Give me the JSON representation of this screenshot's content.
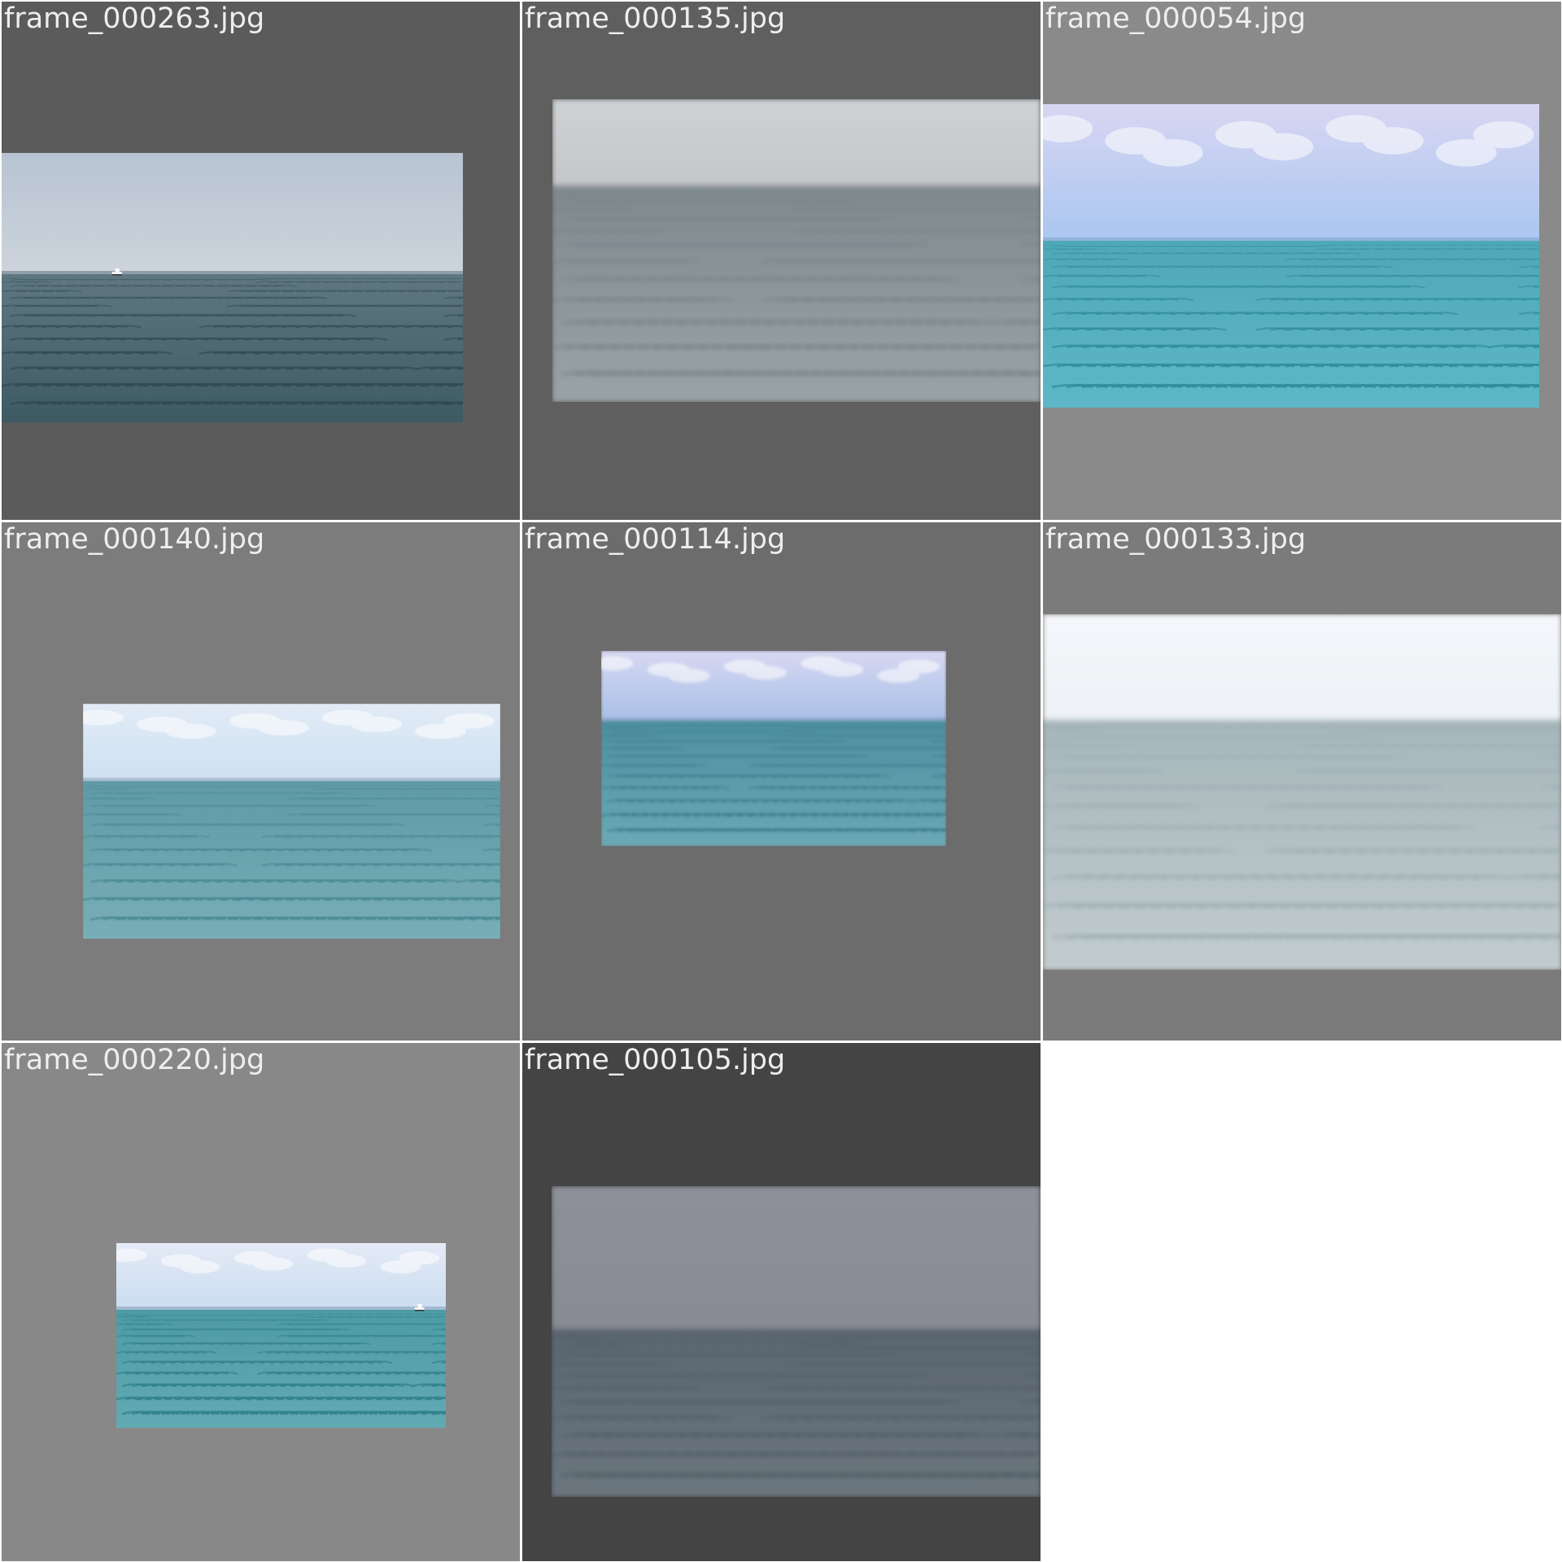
{
  "tiles": [
    {
      "filename": "frame_000263.jpg",
      "background": "#5b5b5b",
      "scene": {
        "sky_top": "#b8c4d2",
        "sky_bottom": "#cdd4dc",
        "horizon_fraction": 0.45,
        "water_top": "#5f7781",
        "water_bottom": "#3d5a63",
        "wave": "#2f4a52",
        "haze": "#8a98a4",
        "boat": true,
        "blur": 0
      }
    },
    {
      "filename": "frame_000135.jpg",
      "background": "#5f5f5f",
      "scene": {
        "sky_top": "#cfd2d5",
        "sky_bottom": "#c4c7ca",
        "horizon_fraction": 0.29,
        "water_top": "#7f8a8f",
        "water_bottom": "#9aa3a6",
        "wave": "#6a767b",
        "haze": "#9aa0a4",
        "boat": false,
        "blur": 3
      }
    },
    {
      "filename": "frame_000054.jpg",
      "background": "#8a8a8a",
      "scene": {
        "sky_top": "#d8d6f2",
        "sky_bottom": "#a9c6f0",
        "horizon_fraction": 0.45,
        "water_top": "#4fa8b8",
        "water_bottom": "#5cb7c6",
        "wave": "#2e8a98",
        "haze": "#8eb0d8",
        "boat": false,
        "blur": 0,
        "clouds": true
      }
    },
    {
      "filename": "frame_000140.jpg",
      "background": "#7c7c7c",
      "scene": {
        "sky_top": "#e2ebf6",
        "sky_bottom": "#cde0f2",
        "horizon_fraction": 0.33,
        "water_top": "#5f9aa6",
        "water_bottom": "#78aeb7",
        "wave": "#4a8894",
        "haze": "#a9bccb",
        "boat": false,
        "blur": 0.6,
        "clouds": true
      }
    },
    {
      "filename": "frame_000114.jpg",
      "background": "#6c6c6c",
      "scene": {
        "sky_top": "#d7d8f3",
        "sky_bottom": "#a7bfe6",
        "horizon_fraction": 0.36,
        "water_top": "#4d8fa0",
        "water_bottom": "#6aa9b5",
        "wave": "#3a7a8a",
        "haze": "#8ba6c7",
        "boat": false,
        "blur": 1.5,
        "clouds": true
      }
    },
    {
      "filename": "frame_000133.jpg",
      "background": "#7b7b7b",
      "scene": {
        "sky_top": "#f4f6fa",
        "sky_bottom": "#eef2f6",
        "horizon_fraction": 0.3,
        "water_top": "#a6b6ba",
        "water_bottom": "#c2cccf",
        "wave": "#8c9ea3",
        "haze": "#d4dbe0",
        "boat": false,
        "blur": 3
      }
    },
    {
      "filename": "frame_000220.jpg",
      "background": "#888888",
      "scene": {
        "sky_top": "#e4eaf6",
        "sky_bottom": "#c9dcf0",
        "horizon_fraction": 0.36,
        "water_top": "#4d9ba5",
        "water_bottom": "#62aab3",
        "wave": "#2f7f8a",
        "haze": "#9fb5cc",
        "boat": true,
        "blur": 0,
        "clouds": true
      }
    },
    {
      "filename": "frame_000105.jpg",
      "background": "#444444",
      "scene": {
        "sky_top": "#8e9099",
        "sky_bottom": "#888b95",
        "horizon_fraction": 0.46,
        "water_top": "#5a6670",
        "water_bottom": "#6b767f",
        "wave": "#48535c",
        "haze": "#7d828c",
        "boat": false,
        "blur": 3
      }
    }
  ]
}
